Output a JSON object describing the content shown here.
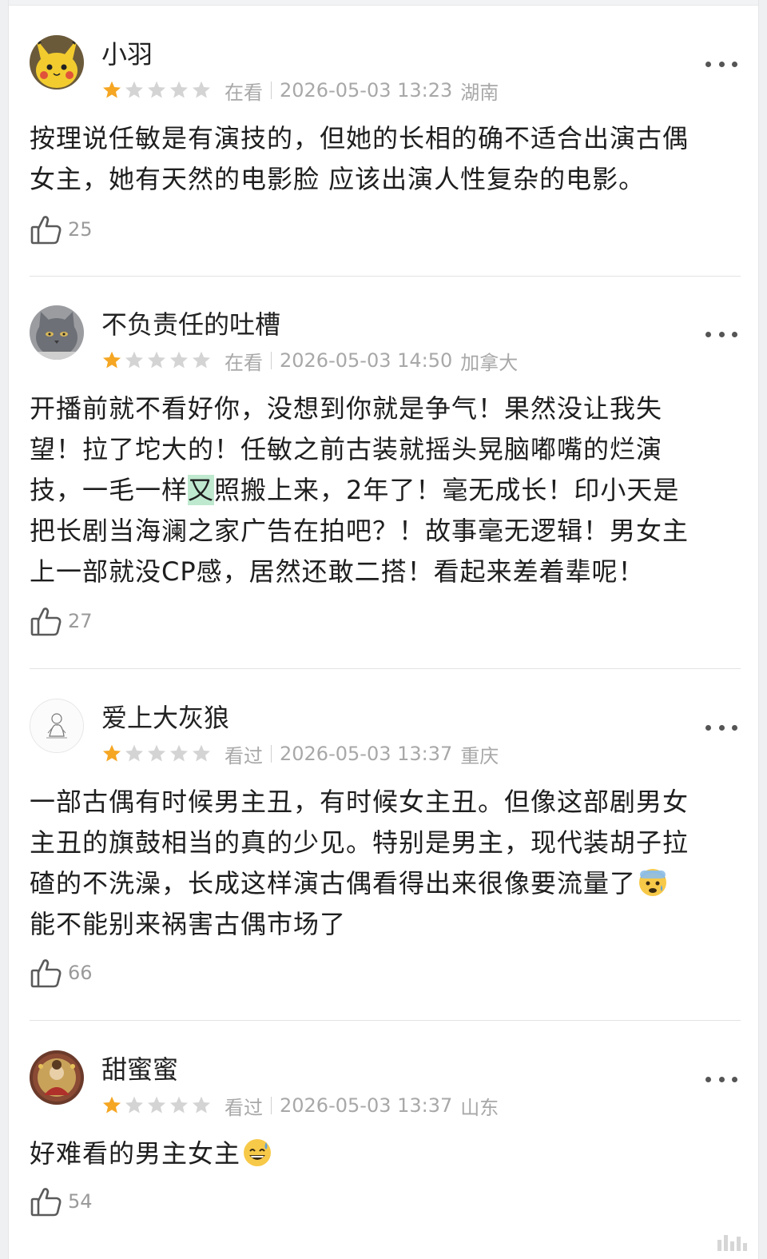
{
  "reviews": [
    {
      "username": "小羽",
      "rating": 1,
      "rating_max": 5,
      "status": "在看",
      "datetime": "2026-05-03 13:23",
      "location": "湖南",
      "content_lines": [
        "按理说任敏是有演技的，但她的长相的确不适合出演古偶",
        "女主，她有天然的电影脸 应该出演人性复杂的电影。"
      ],
      "likes": "25",
      "avatar_icon": "pikachu-avatar"
    },
    {
      "username": "不负责任的吐槽",
      "rating": 1,
      "rating_max": 5,
      "status": "在看",
      "datetime": "2026-05-03 14:50",
      "location": "加拿大",
      "content_lines": [
        "开播前就不看好你，没想到你就是争气！果然没让我失",
        "望！拉了坨大的！任敏之前古装就摇头晃脑嘟嘴的烂演",
        "技，一毛一样",
        "照搬上来，2年了！毫无成长！印小天是",
        "把长剧当海澜之家广告在拍吧？！故事毫无逻辑！男女主",
        "上一部就没CP感，居然还敢二搭！看起来差着辈呢！"
      ],
      "highlighted_char": "又",
      "likes": "27",
      "avatar_icon": "gray-cat-avatar"
    },
    {
      "username": "爱上大灰狼",
      "rating": 1,
      "rating_max": 5,
      "status": "看过",
      "datetime": "2026-05-03 13:37",
      "location": "重庆",
      "content_lines": [
        "一部古偶有时候男主丑，有时候女主丑。但像这部剧男女",
        "主丑的旗鼓相当的真的少见。特别是男主，现代装胡子拉",
        "碴的不洗澡，长成这样演古偶看得出来很像要流量了",
        "能不能别来祸害古偶市场了"
      ],
      "emoji": "fearful-face-emoji",
      "likes": "66",
      "avatar_icon": "sketch-avatar"
    },
    {
      "username": "甜蜜蜜",
      "rating": 1,
      "rating_max": 5,
      "status": "看过",
      "datetime": "2026-05-03 13:37",
      "location": "山东",
      "content_lines": [
        "好难看的男主女主"
      ],
      "emoji": "sweat-smile-emoji",
      "likes": "54",
      "avatar_icon": "ornate-portrait-avatar"
    }
  ],
  "colors": {
    "star_filled": "#f5a623",
    "star_empty": "#d4d4d4",
    "meta_text": "#a8a8a8",
    "highlight": "#bfe9cf"
  }
}
